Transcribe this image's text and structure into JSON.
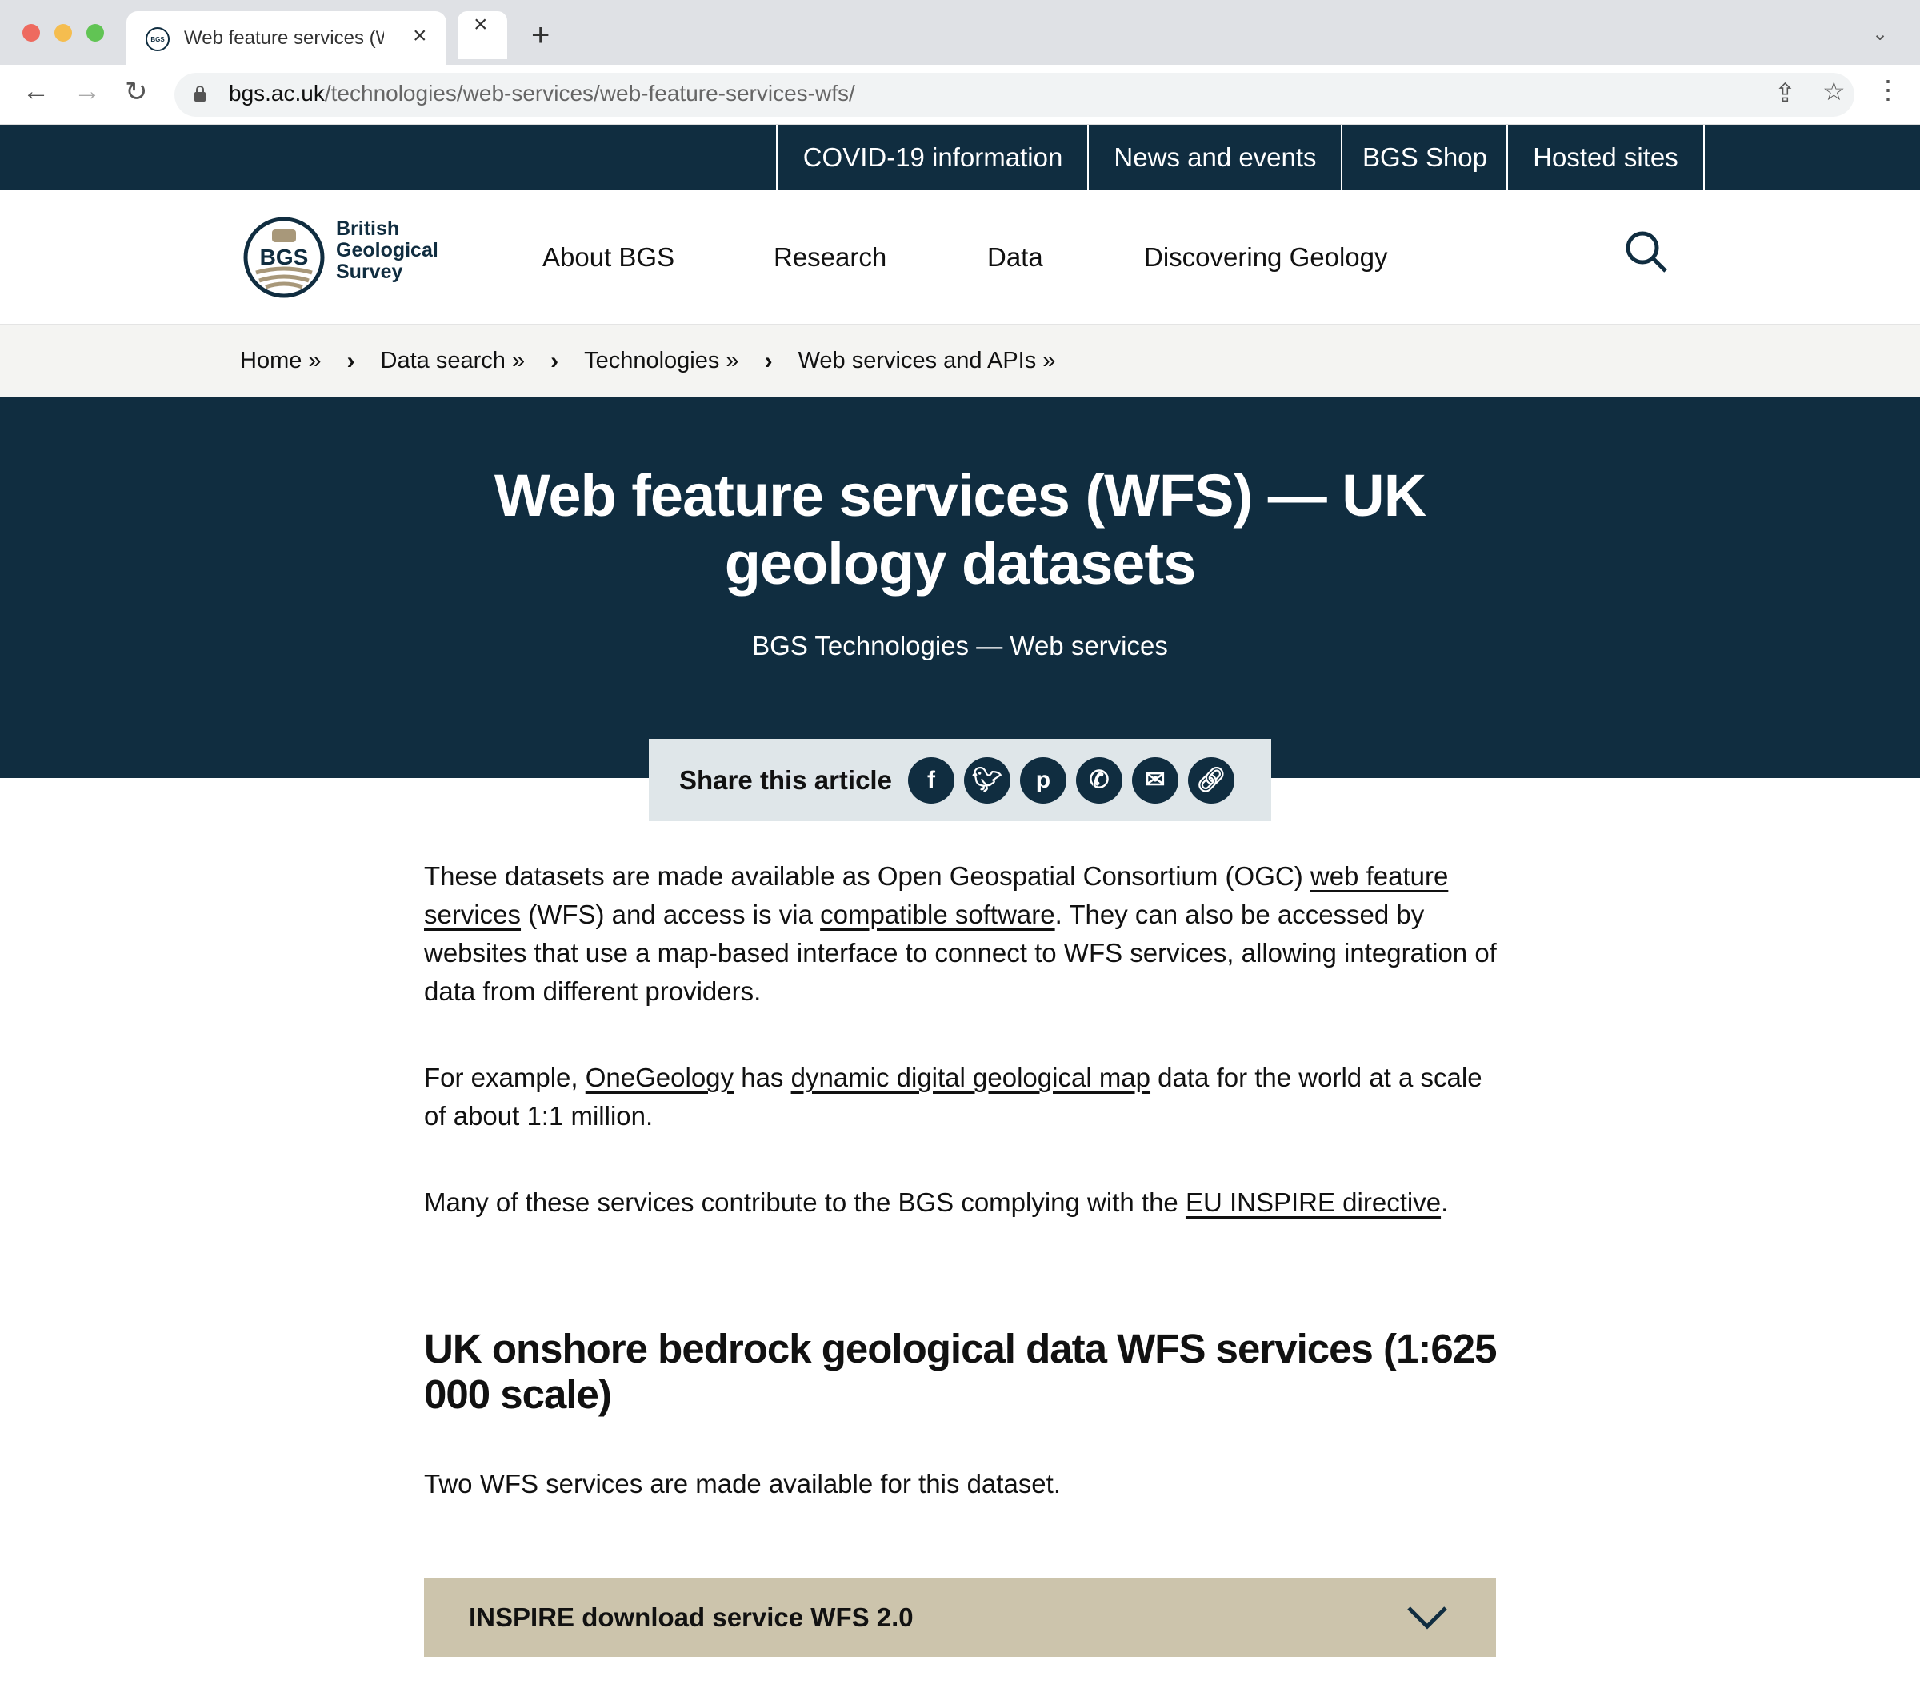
{
  "browser": {
    "tab_title": "Web feature services (WFS) — UK geology datasets",
    "favicon_text": "BGS",
    "url_domain": "bgs.ac.uk",
    "url_path": "/technologies/web-services/web-feature-services-wfs/"
  },
  "topnav": [
    "COVID-19 information",
    "News and events",
    "BGS Shop",
    "Hosted sites"
  ],
  "logo": {
    "mark": "BGS",
    "line1": "British",
    "line2": "Geological",
    "line3": "Survey"
  },
  "mainnav": [
    "About BGS",
    "Research",
    "Data",
    "Discovering Geology"
  ],
  "breadcrumb": [
    "Home »",
    "Data search »",
    "Technologies »",
    "Web services and APIs »"
  ],
  "hero": {
    "title": "Web feature services (WFS) — UK geology datasets",
    "subtitle": "BGS Technologies — Web services"
  },
  "share": {
    "label": "Share this article",
    "icons": [
      "facebook-icon",
      "twitter-icon",
      "pinterest-icon",
      "whatsapp-icon",
      "email-icon",
      "link-icon"
    ]
  },
  "content": {
    "p1": {
      "a": "These datasets are made available as Open Geospatial Consortium (OGC) ",
      "link1": "web feature services",
      "b": " (WFS) and access is via ",
      "link2": "compatible software",
      "c": ". They can also be accessed by websites that use a map-based interface to connect to WFS services, allowing integration of data from different providers."
    },
    "p2": {
      "a": "For example, ",
      "link1": "OneGeology",
      "b": " has ",
      "link2": "dynamic digital geological map",
      "c": " data for the world at a scale of about 1:1 million."
    },
    "p3": {
      "a": "Many of these services contribute to the BGS complying with the ",
      "link1": "EU INSPIRE directive",
      "b": "."
    },
    "h2": "UK onshore bedrock geological data WFS services (1:625 000 scale)",
    "p4": "Two WFS services are made available for this dataset."
  },
  "accordion": {
    "title": "INSPIRE download service WFS 2.0"
  },
  "colors": {
    "navy": "#102d40",
    "sand": "#ccc4ac",
    "share_bg": "#dfe6e9"
  }
}
